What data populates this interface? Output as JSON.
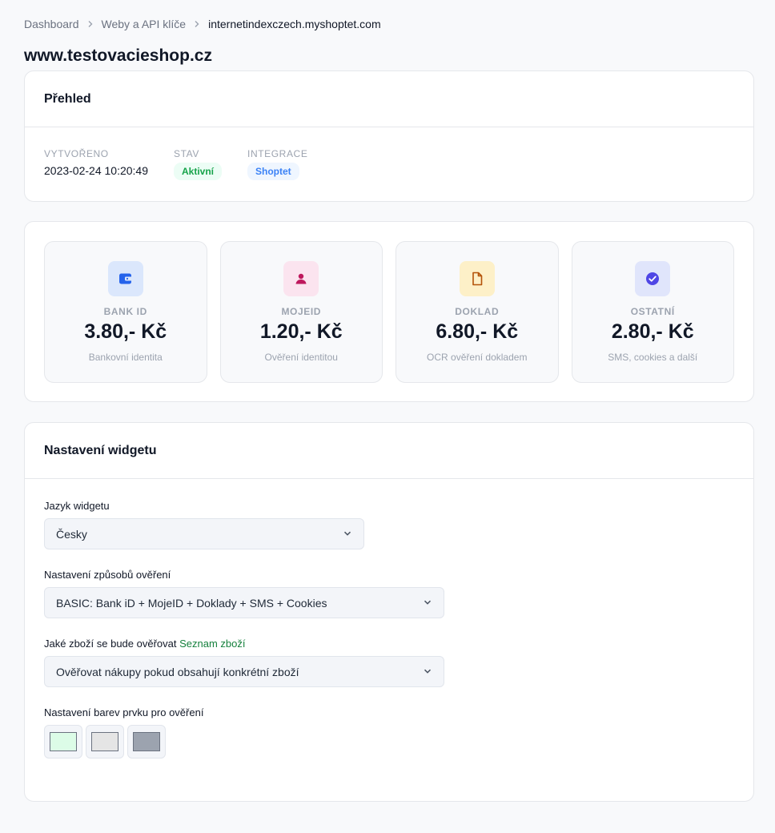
{
  "breadcrumb": [
    "Dashboard",
    "Weby a API klíče",
    "internetindexczech.myshoptet.com"
  ],
  "page_title": "www.testovacieshop.cz",
  "overview": {
    "heading": "Přehled",
    "created_label": "VYTVOŘENO",
    "created_value": "2023-02-24 10:20:49",
    "status_label": "STAV",
    "status_value": "Aktivní",
    "integration_label": "INTEGRACE",
    "integration_value": "Shoptet"
  },
  "pricing": [
    {
      "label": "BANK ID",
      "value": "3.80,- Kč",
      "desc": "Bankovní identita",
      "icon": "wallet-icon",
      "icon_bg": "#dbe7fc",
      "icon_color": "#2563eb"
    },
    {
      "label": "MOJEID",
      "value": "1.20,- Kč",
      "desc": "Ověření identitou",
      "icon": "user-icon",
      "icon_bg": "#fbe4ef",
      "icon_color": "#be185d"
    },
    {
      "label": "DOKLAD",
      "value": "6.80,- Kč",
      "desc": "OCR ověření dokladem",
      "icon": "document-icon",
      "icon_bg": "#fdf0c8",
      "icon_color": "#b45309"
    },
    {
      "label": "OSTATNÍ",
      "value": "2.80,- Kč",
      "desc": "SMS, cookies a další",
      "icon": "check-badge-icon",
      "icon_bg": "#e0e5fb",
      "icon_color": "#4f46e5"
    }
  ],
  "widget": {
    "heading": "Nastavení widgetu",
    "language_label": "Jazyk widgetu",
    "language_value": "Česky",
    "methods_label": "Nastavení způsobů ověření",
    "methods_value": "BASIC: Bank iD + MojeID + Doklady + SMS + Cookies",
    "goods_label": "Jaké zboží se bude ověřovat",
    "goods_link": "Seznam zboží",
    "goods_value": "Ověřovat nákupy pokud obsahují konkrétní zboží",
    "colors_label": "Nastavení barev prvku pro ověření",
    "colors": [
      "#dcfce7",
      "#e5e5e5",
      "#9ca3af"
    ]
  }
}
